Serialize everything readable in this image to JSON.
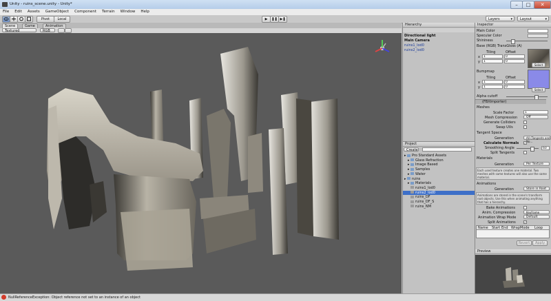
{
  "window": {
    "title": "Unity - ruins_scene.unity - Unity*"
  },
  "menu": [
    "File",
    "Edit",
    "Assets",
    "GameObject",
    "Component",
    "Terrain",
    "Window",
    "Help"
  ],
  "toolbar": {
    "tools": [
      "hand",
      "move",
      "rotate",
      "scale"
    ],
    "pivot_label": "Pivot",
    "local_label": "Local",
    "play": "▶",
    "pause": "❚❚",
    "step": "▶❚",
    "layers_label": "Layers",
    "layout_label": "Layout"
  },
  "scene_tabs": [
    "Scene",
    "Game",
    "Animation"
  ],
  "scene_bar": {
    "render_mode": "Textured",
    "color_mode": "RGB"
  },
  "hierarchy": {
    "title": "Hierarchy",
    "create_label": "Create",
    "items": [
      {
        "label": "Directional light",
        "selected": false
      },
      {
        "label": "Main Camera",
        "selected": false
      },
      {
        "label": "ruins1_lod0",
        "selected": false
      },
      {
        "label": "ruins2_lod0",
        "selected": false
      }
    ]
  },
  "project": {
    "title": "Project",
    "create_label": "Create",
    "items": [
      {
        "label": "Pro Standard Assets",
        "depth": 0,
        "folder": true
      },
      {
        "label": "Glass Refraction",
        "depth": 1,
        "folder": true
      },
      {
        "label": "Image Based",
        "depth": 1,
        "folder": true
      },
      {
        "label": "Samples",
        "depth": 1,
        "folder": true
      },
      {
        "label": "Water",
        "depth": 1,
        "folder": true
      },
      {
        "label": "ruins",
        "depth": 0,
        "folder": true
      },
      {
        "label": "Materials",
        "depth": 1,
        "folder": true
      },
      {
        "label": "ruins1_lod0",
        "depth": 1,
        "folder": false
      },
      {
        "label": "ruins2_lod0",
        "depth": 1,
        "folder": false
      },
      {
        "label": "ruins_DF",
        "depth": 1,
        "folder": false
      },
      {
        "label": "ruins_DF_S",
        "depth": 1,
        "folder": false
      },
      {
        "label": "ruins_NM",
        "depth": 1,
        "folder": false
      }
    ],
    "selected_index": 8
  },
  "inspector": {
    "title": "Inspector",
    "main_color_label": "Main Color",
    "specular_color_label": "Specular Color",
    "shininess_label": "Shininess",
    "base_label": "Base (RGB) TransGloss (A)",
    "tiling_label": "Tiling",
    "offset_label": "Offset",
    "x_label": "x",
    "y_label": "y",
    "tiling_x": "1",
    "tiling_y": "1",
    "offset_x": "0",
    "offset_y": "0",
    "select_label": "Select",
    "bumpmap_label": "Bumpmap",
    "alpha_cutoff_label": "Alpha cutoff",
    "fbx_importer_label": "(FBXImporter)",
    "meshes_label": "Meshes",
    "scale_factor_label": "Scale Factor",
    "scale_factor_value": "1",
    "mesh_compression_label": "Mesh Compression",
    "mesh_compression_value": "Off",
    "generate_colliders_label": "Generate Colliders",
    "swap_uvs_label": "Swap UVs",
    "tangent_space_label": "Tangent Space",
    "generation_label": "Generation",
    "tangent_generation_value": "All (Tangents and No...",
    "calculate_normals_label": "Calculate Normals",
    "smoothing_angle_label": "Smoothing Angle",
    "smoothing_angle_value": "60",
    "split_tangents_label": "Split Tangents",
    "materials_label": "Materials",
    "materials_generation_value": "Per Texture",
    "materials_note": "Each used texture creates one material. Two meshes with same textures will also use the same material.",
    "animations_label": "Animations",
    "anim_generation_value": "Store in Root",
    "anim_note": "Animations are stored in the scene's transform root objects. Use this when animating anything that has a hierarchy.",
    "bake_animations_label": "Bake Animations",
    "anim_compression_label": "Anim. Compression",
    "anim_compression_value": "Keyframe Reduction",
    "wrap_mode_label": "Animation Wrap Mode",
    "wrap_mode_value": "Default",
    "split_animations_label": "Split Animations",
    "split_columns": [
      "Name",
      "Start",
      "End",
      "WrapMode",
      "Loop"
    ],
    "revert_label": "Revert",
    "apply_label": "Apply",
    "preview_label": "Preview",
    "main_color": "#ffffff",
    "specular_color": "#e0e0e0",
    "bumpmap_color": "#8a8ae8"
  },
  "status": {
    "message": "NullReferenceException: Object reference not set to an instance of an object"
  }
}
